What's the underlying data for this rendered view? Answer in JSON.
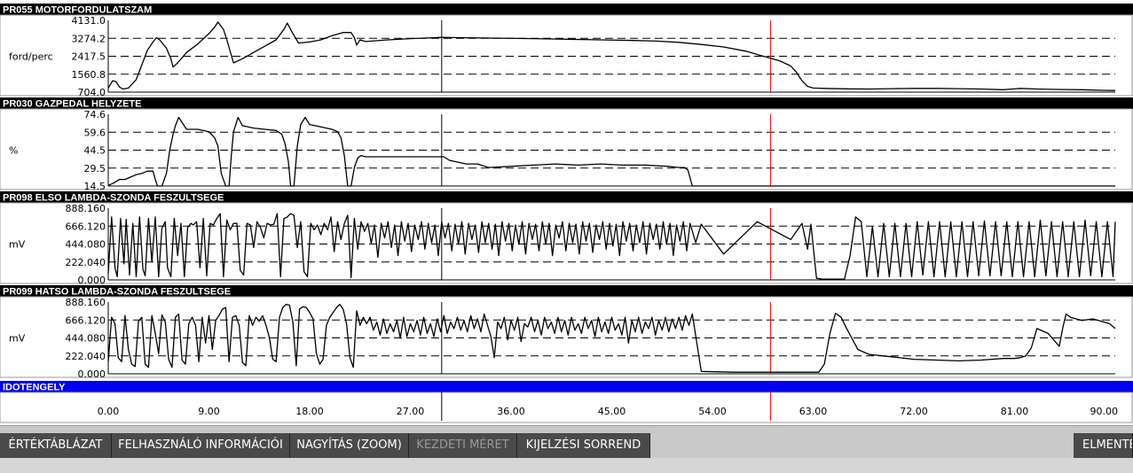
{
  "colors": {
    "header_bg": "#000000",
    "header_text": "#ffffff",
    "time_axis_header": "#0000ee",
    "cursor_red": "#ff0000",
    "trace": "#000000",
    "button_bg": "#4a4a4a",
    "button_text": "#ffffff",
    "button_disabled_text": "#9a9a9a"
  },
  "time_axis": {
    "title": "IDOTENGELY",
    "ticks": [
      "0.00",
      "9.00",
      "18.00",
      "27.00",
      "36.00",
      "45.00",
      "54.00",
      "63.00",
      "72.00",
      "81.00",
      "90.00"
    ],
    "range": [
      0,
      90
    ],
    "marker_black": 29.8,
    "marker_red": 59.2
  },
  "chart_data": [
    {
      "type": "line",
      "title": "PR055  MOTORFORDULATSZAM",
      "ylabel": "ford/perc",
      "yticks": [
        "4131.0",
        "3274.2",
        "2417.5",
        "1560.8",
        "704.0"
      ],
      "ylim": [
        704,
        4131
      ],
      "x": [
        0,
        0.4,
        0.7,
        1.0,
        1.3,
        1.8,
        2.5,
        3.0,
        3.5,
        4.0,
        4.3,
        4.6,
        5.2,
        5.6,
        5.8,
        6.2,
        7.0,
        8.0,
        9.0,
        9.5,
        9.8,
        10.3,
        10.6,
        11.2,
        12.0,
        13.0,
        14.0,
        15.0,
        15.7,
        16.0,
        16.4,
        17.0,
        18.0,
        19.0,
        20.0,
        21.0,
        21.7,
        22.0,
        22.2,
        22.5,
        23.0,
        25.0,
        27.0,
        29.0,
        29.8,
        32.0,
        35.0,
        38.0,
        41.0,
        44.0,
        47.0,
        49.0,
        51.0,
        53.0,
        55.0,
        57.0,
        58.5,
        60.0,
        61.0,
        61.5,
        62.0,
        62.5,
        63.0,
        64.0,
        66.0,
        68.0,
        70.0,
        72.0,
        74.0,
        76.0,
        78.0,
        80.0,
        81.5,
        83.0,
        85.0,
        87.0,
        89.0,
        90.0
      ],
      "values": [
        900,
        1250,
        1200,
        950,
        850,
        900,
        1300,
        2000,
        2700,
        3100,
        3300,
        3200,
        2800,
        2300,
        1900,
        2100,
        2600,
        3000,
        3500,
        3800,
        4050,
        3700,
        3200,
        2100,
        2300,
        2600,
        2900,
        3200,
        3700,
        4000,
        3600,
        3050,
        3100,
        3200,
        3400,
        3550,
        3550,
        3300,
        2950,
        3200,
        3120,
        3200,
        3260,
        3300,
        3320,
        3300,
        3280,
        3260,
        3230,
        3200,
        3170,
        3140,
        3080,
        2980,
        2860,
        2660,
        2420,
        2200,
        1950,
        1650,
        1250,
        980,
        900,
        880,
        860,
        850,
        870,
        880,
        880,
        870,
        850,
        820,
        880,
        850,
        830,
        820,
        790,
        780
      ]
    },
    {
      "type": "line",
      "title": "PR030  GAZPEDAL HELYZETE",
      "ylabel": "%",
      "yticks": [
        "74.6",
        "59.6",
        "44.5",
        "29.5",
        "14.5"
      ],
      "ylim": [
        14.5,
        74.6
      ],
      "x": [
        0,
        0.5,
        1.0,
        1.5,
        2.0,
        2.5,
        3.0,
        3.5,
        4.0,
        4.2,
        4.4,
        4.8,
        5.2,
        5.5,
        5.8,
        6.0,
        6.3,
        7.0,
        8.0,
        9.0,
        9.5,
        9.8,
        10.1,
        10.5,
        10.8,
        11.0,
        11.2,
        11.6,
        12.0,
        13.0,
        14.0,
        15.0,
        15.5,
        15.8,
        16.1,
        16.3,
        16.6,
        16.9,
        17.2,
        17.6,
        18.0,
        19.0,
        20.0,
        20.5,
        20.8,
        21.1,
        21.4,
        21.7,
        22.0,
        22.3,
        22.6,
        23.0,
        25.0,
        27.0,
        29.0,
        30.0,
        30.5,
        31.0,
        32.0,
        33.0,
        34.0,
        36.0,
        38.0,
        40.0,
        42.0,
        44.0,
        46.0,
        48.0,
        50.0,
        51.0,
        51.5,
        51.8,
        52.2,
        52.5,
        53.0,
        56.0,
        60.0,
        65.0,
        70.0,
        75.0,
        80.0,
        85.0,
        90.0
      ],
      "values": [
        15,
        17,
        20,
        20,
        22,
        24,
        25,
        27,
        27,
        20,
        14.5,
        14.5,
        25,
        45,
        58,
        65,
        72,
        62,
        62,
        60,
        55,
        48,
        25,
        14.5,
        14.5,
        40,
        60,
        72,
        65,
        63,
        62,
        61,
        58,
        50,
        35,
        14.5,
        14.5,
        48,
        66,
        72,
        66,
        64,
        62,
        60,
        55,
        40,
        14.5,
        14.5,
        30,
        38,
        40,
        39,
        39,
        39,
        39,
        39,
        36,
        35,
        33,
        33,
        30,
        31,
        32,
        33,
        32,
        33,
        32,
        32,
        31,
        30,
        30,
        28,
        14.5,
        14.5,
        14.5,
        14.5,
        14.5,
        14.5,
        14.5,
        14.5,
        14.5,
        14.5,
        14.5
      ]
    },
    {
      "type": "line",
      "title": "PR098  ELSO LAMBDA-SZONDA FESZULTSEGE",
      "ylabel": "mV",
      "yticks": [
        "888.160",
        "666.120",
        "444.080",
        "222.040",
        "0.000"
      ],
      "ylim": [
        0,
        888.16
      ],
      "x": [
        0,
        0.3,
        0.6,
        0.8,
        1.1,
        1.4,
        1.6,
        1.9,
        2.2,
        2.5,
        2.8,
        3.1,
        3.3,
        3.6,
        3.9,
        4.2,
        4.5,
        4.8,
        5.1,
        5.3,
        5.6,
        5.9,
        6.2,
        6.5,
        6.8,
        7.1,
        7.4,
        7.6,
        7.9,
        8.2,
        8.5,
        8.8,
        9.1,
        9.4,
        9.7,
        10.0,
        10.3,
        10.6,
        10.9,
        11.2,
        11.5,
        11.8,
        12.1,
        12.4,
        12.7,
        13.0,
        13.3,
        13.6,
        13.9,
        14.2,
        14.5,
        14.8,
        15.1,
        15.4,
        15.7,
        16.0,
        16.3,
        16.6,
        16.9,
        17.2,
        17.5,
        17.8,
        18.1,
        18.4,
        18.7,
        19.0,
        19.3,
        19.6,
        19.9,
        20.2,
        20.5,
        20.8,
        21.1,
        21.4,
        21.7,
        22.0,
        22.3,
        22.6,
        22.9,
        23.2,
        23.5,
        23.8,
        24.1,
        24.4,
        24.7,
        25.0,
        25.3,
        25.6,
        25.9,
        26.2,
        26.5,
        26.8,
        27.1,
        27.4,
        27.7,
        28.0,
        28.3,
        28.6,
        28.9,
        29.2,
        29.5,
        29.8,
        30.1,
        30.4,
        30.7,
        31.0,
        31.3,
        31.6,
        31.9,
        32.2,
        32.5,
        32.8,
        33.1,
        33.4,
        33.7,
        34.0,
        34.3,
        34.6,
        34.9,
        35.2,
        35.5,
        35.8,
        36.1,
        36.4,
        36.7,
        37.0,
        37.3,
        37.6,
        37.9,
        38.2,
        38.5,
        38.8,
        39.1,
        39.4,
        39.7,
        40.0,
        40.3,
        40.6,
        40.9,
        41.2,
        41.5,
        41.8,
        42.1,
        42.4,
        42.7,
        43.0,
        43.3,
        43.6,
        43.9,
        44.2,
        44.5,
        44.8,
        45.1,
        45.4,
        45.7,
        46.0,
        46.3,
        46.6,
        46.9,
        47.2,
        47.5,
        47.8,
        48.1,
        48.4,
        48.7,
        49.0,
        49.3,
        49.6,
        49.9,
        50.2,
        50.5,
        50.8,
        51.1,
        51.4,
        51.7,
        52.0,
        52.5,
        53.0,
        55.0,
        58.0,
        61.0,
        62.0,
        62.5,
        62.8,
        63.3,
        63.8,
        64.3,
        64.8,
        65.3,
        65.8,
        66.3,
        66.8,
        67.3,
        67.8,
        68.3,
        68.8,
        69.3,
        69.8,
        70.3,
        70.8,
        71.3,
        71.8,
        72.3,
        72.8,
        73.3,
        73.8,
        74.3,
        74.8,
        75.3,
        75.8,
        76.3,
        76.8,
        77.3,
        77.8,
        78.3,
        78.8,
        79.3,
        79.8,
        80.3,
        80.8,
        81.3,
        81.8,
        82.3,
        82.8,
        83.3,
        83.8,
        84.3,
        84.8,
        85.3,
        85.8,
        86.3,
        86.8,
        87.3,
        87.8,
        88.3,
        88.8,
        89.3,
        89.8,
        90.0
      ],
      "values": [
        80,
        780,
        150,
        40,
        760,
        200,
        750,
        60,
        700,
        40,
        780,
        130,
        50,
        760,
        220,
        780,
        40,
        640,
        720,
        150,
        40,
        760,
        300,
        700,
        40,
        650,
        700,
        680,
        720,
        150,
        760,
        50,
        700,
        680,
        760,
        820,
        40,
        740,
        620,
        700,
        700,
        120,
        60,
        700,
        680,
        400,
        720,
        650,
        520,
        700,
        680,
        690,
        820,
        40,
        760,
        780,
        820,
        800,
        400,
        720,
        100,
        40,
        700,
        620,
        680,
        560,
        700,
        620,
        780,
        350,
        720,
        500,
        700,
        800,
        30,
        760,
        380,
        720,
        600,
        700,
        450,
        680,
        280,
        700,
        520,
        720,
        400,
        680,
        300,
        720,
        480,
        700,
        350,
        680,
        500,
        720,
        380,
        700,
        460,
        680,
        300,
        720,
        520,
        700,
        360,
        690,
        440,
        720,
        320,
        700,
        500,
        680,
        340,
        720,
        460,
        700,
        380,
        690,
        300,
        720,
        480,
        700,
        360,
        680,
        440,
        720,
        320,
        700,
        500,
        690,
        360,
        720,
        440,
        700,
        300,
        680,
        520,
        720,
        360,
        700,
        460,
        690,
        320,
        720,
        480,
        700,
        340,
        680,
        500,
        720,
        380,
        700,
        420,
        690,
        300,
        720,
        480,
        700,
        360,
        680,
        460,
        720,
        320,
        700,
        500,
        690,
        380,
        720,
        440,
        700,
        300,
        680,
        480,
        720,
        360,
        700,
        460,
        690,
        320,
        720,
        500,
        700,
        380,
        690,
        20,
        10,
        10,
        10,
        10,
        10,
        300,
        780,
        720,
        40,
        660,
        40,
        700,
        40,
        700,
        40,
        700,
        40,
        720,
        60,
        720,
        40,
        720,
        40,
        720,
        40,
        720,
        40,
        720,
        50,
        730,
        50,
        720,
        50,
        720,
        40,
        720,
        40,
        720,
        40,
        740,
        50,
        720,
        40,
        720,
        40,
        720,
        40,
        740,
        50,
        720,
        40,
        720,
        40,
        720,
        40,
        740,
        80
      ]
    },
    {
      "type": "line",
      "title": "PR099  HATSO LAMBDA-SZONDA FESZULTSEGE",
      "ylabel": "mV",
      "yticks": [
        "888.160",
        "666.120",
        "444.080",
        "222.040",
        "0.000"
      ],
      "ylim": [
        0,
        888.16
      ],
      "x": [
        0,
        0.3,
        0.6,
        0.9,
        1.2,
        1.5,
        1.8,
        2.1,
        2.4,
        2.7,
        3.0,
        3.3,
        3.6,
        3.9,
        4.2,
        4.5,
        4.8,
        5.1,
        5.4,
        5.7,
        6.0,
        6.3,
        6.6,
        6.9,
        7.2,
        7.5,
        7.8,
        8.1,
        8.4,
        8.7,
        9.0,
        9.3,
        9.6,
        9.9,
        10.2,
        10.5,
        10.8,
        11.1,
        11.4,
        11.7,
        12.0,
        12.3,
        12.6,
        12.9,
        13.2,
        13.5,
        13.8,
        14.1,
        14.4,
        14.7,
        15.0,
        15.3,
        15.6,
        15.9,
        16.2,
        16.5,
        16.8,
        17.1,
        17.4,
        17.7,
        18.0,
        18.3,
        18.6,
        18.9,
        19.2,
        19.5,
        19.8,
        20.1,
        20.4,
        20.7,
        21.0,
        21.3,
        21.6,
        21.9,
        22.2,
        22.5,
        22.8,
        23.1,
        23.4,
        23.7,
        24.0,
        24.3,
        24.6,
        24.9,
        25.2,
        25.5,
        25.8,
        26.1,
        26.4,
        26.7,
        27.0,
        27.3,
        27.6,
        27.9,
        28.2,
        28.5,
        28.8,
        29.1,
        29.4,
        29.7,
        30.0,
        30.3,
        30.6,
        30.9,
        31.2,
        31.5,
        31.8,
        32.1,
        32.4,
        32.7,
        33.0,
        33.3,
        33.6,
        33.9,
        34.2,
        34.5,
        34.8,
        35.1,
        35.4,
        35.7,
        36.0,
        36.3,
        36.6,
        36.9,
        37.2,
        37.5,
        37.8,
        38.1,
        38.4,
        38.7,
        39.0,
        39.3,
        39.6,
        39.9,
        40.2,
        40.5,
        40.8,
        41.1,
        41.4,
        41.7,
        42.0,
        42.3,
        42.6,
        42.9,
        43.2,
        43.5,
        43.8,
        44.1,
        44.4,
        44.7,
        45.0,
        45.3,
        45.6,
        45.9,
        46.2,
        46.5,
        46.8,
        47.1,
        47.4,
        47.7,
        48.0,
        48.3,
        48.6,
        48.9,
        49.2,
        49.5,
        49.8,
        50.1,
        50.4,
        50.7,
        51.0,
        51.3,
        51.6,
        51.9,
        52.2,
        53.0,
        56.0,
        60.0,
        63.0,
        63.5,
        64.0,
        64.5,
        65.0,
        65.5,
        66.0,
        67.0,
        68.0,
        70.0,
        72.0,
        74.0,
        76.0,
        78.0,
        80.0,
        81.0,
        81.5,
        82.0,
        82.5,
        83.0,
        84.0,
        85.0,
        85.3,
        85.6,
        86.0,
        87.0,
        88.0,
        89.0,
        89.5,
        90.0
      ],
      "values": [
        150,
        700,
        620,
        200,
        150,
        720,
        300,
        120,
        90,
        650,
        700,
        120,
        80,
        720,
        500,
        250,
        730,
        640,
        180,
        80,
        700,
        740,
        170,
        120,
        620,
        700,
        600,
        150,
        700,
        380,
        720,
        300,
        660,
        720,
        800,
        820,
        150,
        700,
        720,
        600,
        140,
        100,
        720,
        600,
        700,
        650,
        720,
        600,
        450,
        180,
        150,
        700,
        820,
        860,
        850,
        640,
        100,
        800,
        830,
        820,
        760,
        680,
        250,
        120,
        180,
        600,
        700,
        760,
        820,
        860,
        800,
        620,
        200,
        80,
        780,
        600,
        700,
        620,
        700,
        540,
        640,
        480,
        680,
        500,
        620,
        520,
        660,
        440,
        700,
        460,
        620,
        520,
        660,
        480,
        700,
        500,
        620,
        460,
        680,
        520,
        720,
        500,
        640,
        560,
        700,
        540,
        660,
        520,
        720,
        560,
        680,
        520,
        740,
        600,
        460,
        200,
        640,
        560,
        700,
        420,
        660,
        540,
        700,
        400,
        620,
        580,
        700,
        520,
        660,
        480,
        700,
        560,
        640,
        500,
        700,
        520,
        660,
        480,
        700,
        540,
        620,
        500,
        700,
        560,
        660,
        460,
        700,
        520,
        640,
        500,
        700,
        540,
        620,
        480,
        700,
        380,
        660,
        520,
        700,
        500,
        640,
        560,
        700,
        480,
        660,
        540,
        700,
        520,
        680,
        560,
        700,
        540,
        720,
        600,
        740,
        30,
        20,
        20,
        20,
        20,
        120,
        500,
        750,
        700,
        560,
        300,
        240,
        210,
        180,
        170,
        160,
        170,
        190,
        190,
        200,
        220,
        320,
        560,
        500,
        340,
        560,
        740,
        700,
        660,
        680,
        640,
        620,
        560,
        540,
        570,
        600,
        640,
        700,
        680
      ]
    }
  ],
  "toolbar": {
    "buttons": [
      {
        "label": "ÉRTÉKTÁBLÁZAT",
        "enabled": true
      },
      {
        "label": "FELHASZNÁLÓ INFORMÁCIÓI",
        "enabled": true
      },
      {
        "label": "NAGYÍTÁS (ZOOM)",
        "enabled": true
      },
      {
        "label": "KEZDETI MÉRET",
        "enabled": false
      },
      {
        "label": "KIJELZÉSI SORREND",
        "enabled": true
      }
    ],
    "save_label": "ELMENTE"
  }
}
